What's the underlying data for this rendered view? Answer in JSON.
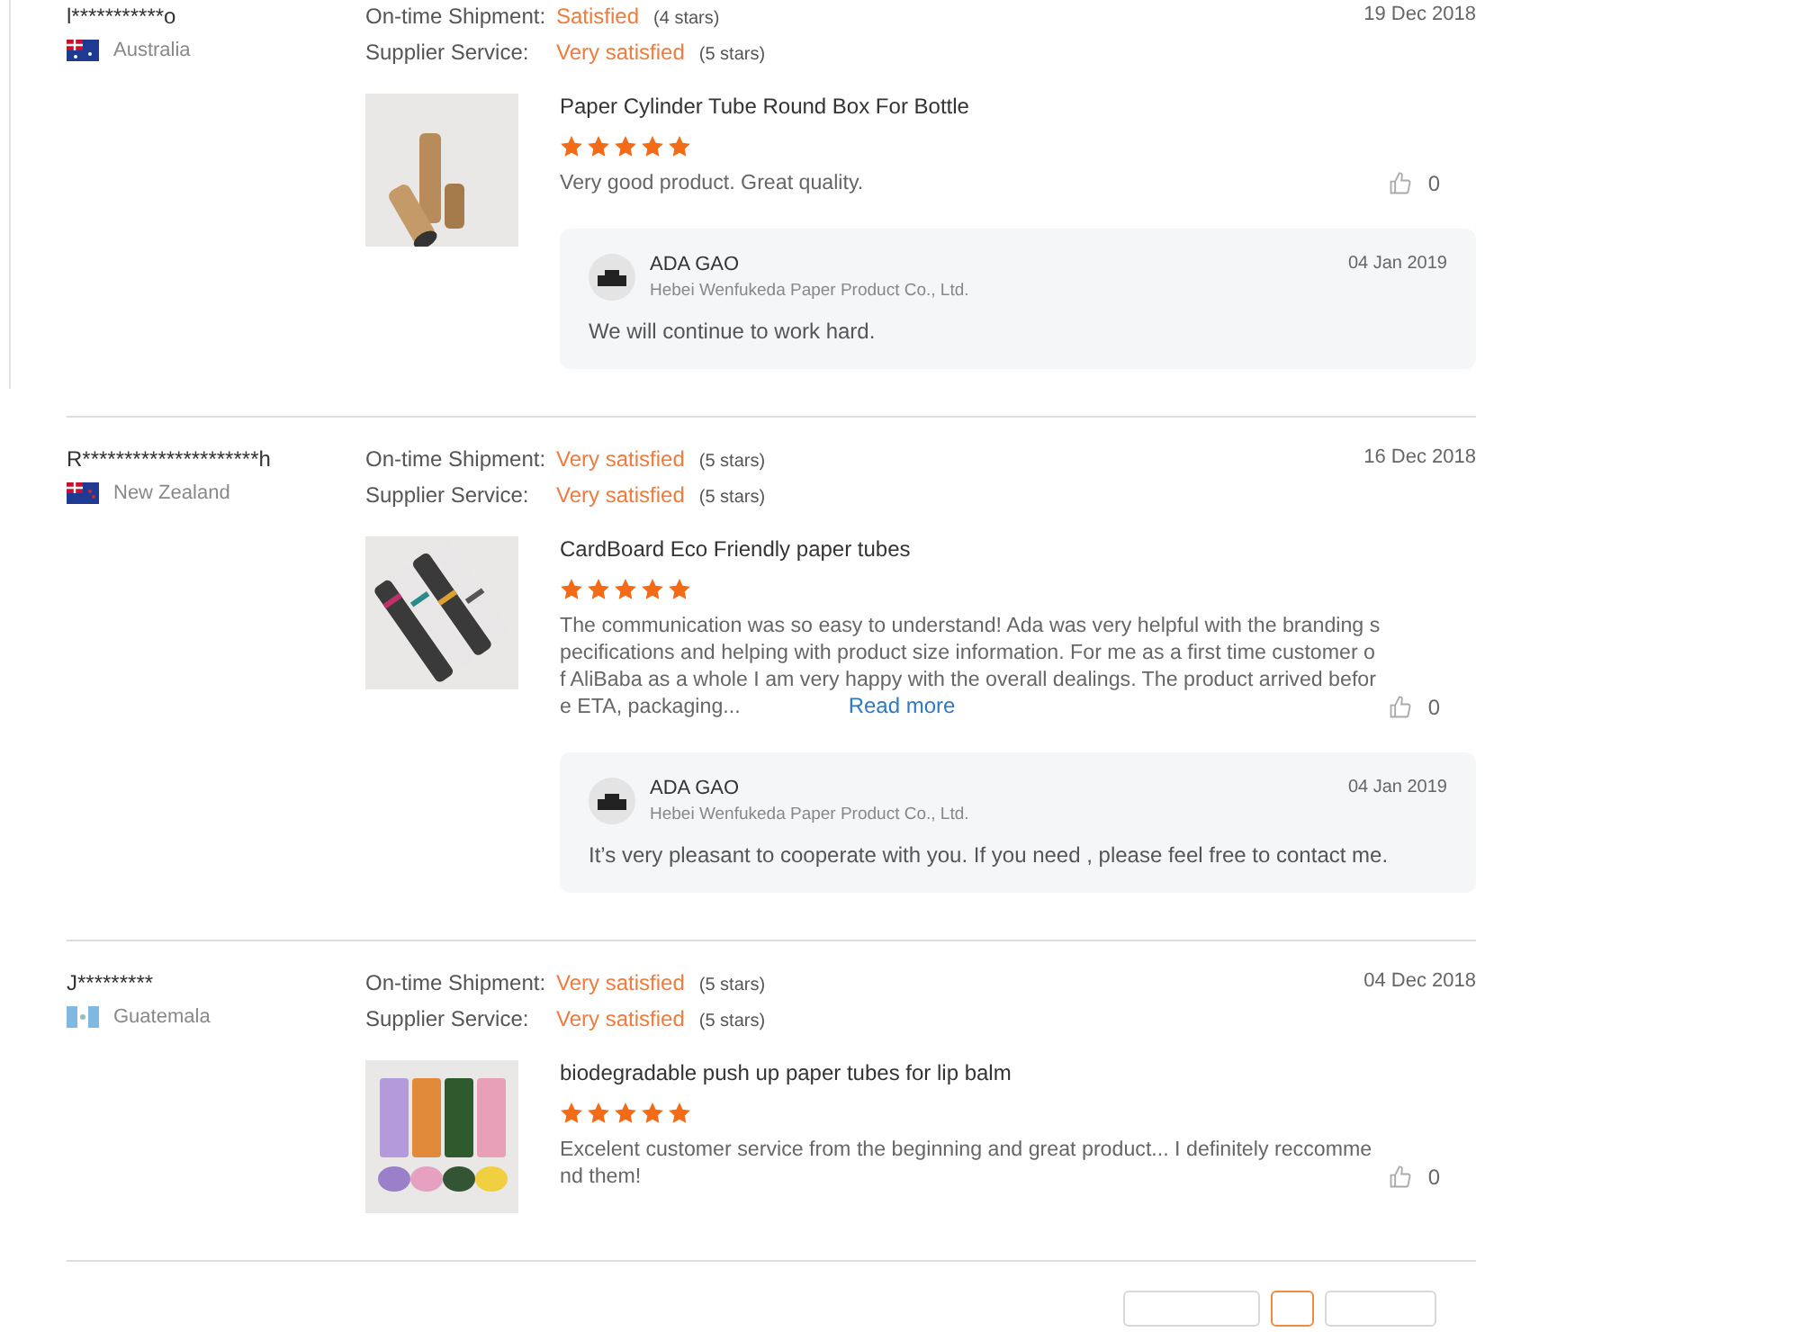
{
  "reviews": [
    {
      "buyer": "l***********o",
      "country": "Australia",
      "date": "19 Dec 2018",
      "ratings": [
        {
          "label": "On-time Shipment:",
          "value": "Satisfied",
          "stars_text": "(4 stars)"
        },
        {
          "label": "Supplier Service:",
          "value": "Very satisfied",
          "stars_text": "(5 stars)"
        }
      ],
      "product": "Paper Cylinder Tube Round Box For Bottle",
      "stars": 5,
      "text": "Very good product. Great quality.",
      "likes": "0",
      "reply": {
        "name": "ADA GAO",
        "company": "Hebei Wenfukeda Paper Product Co., Ltd.",
        "date": "04 Jan 2019",
        "text": "We will continue to work hard."
      }
    },
    {
      "buyer": "R*********************h",
      "country": "New Zealand",
      "date": "16 Dec 2018",
      "ratings": [
        {
          "label": "On-time Shipment:",
          "value": "Very satisfied",
          "stars_text": "(5 stars)"
        },
        {
          "label": "Supplier Service:",
          "value": "Very satisfied",
          "stars_text": "(5 stars)"
        }
      ],
      "product": "CardBoard Eco Friendly paper tubes",
      "stars": 5,
      "text": "The communication was so easy to understand! Ada was very helpful with the branding specifications and helping with product size information. For me as a first time customer of AliBaba as a whole I am very happy with the overall dealings. The product arrived before ETA, packaging...",
      "read_more": "Read more",
      "likes": "0",
      "reply": {
        "name": "ADA GAO",
        "company": "Hebei Wenfukeda Paper Product Co., Ltd.",
        "date": "04 Jan 2019",
        "text": "It’s very pleasant to cooperate with you. If you need , please feel free to contact me."
      }
    },
    {
      "buyer": "J*********",
      "country": "Guatemala",
      "date": "04 Dec 2018",
      "ratings": [
        {
          "label": "On-time Shipment:",
          "value": "Very satisfied",
          "stars_text": "(5 stars)"
        },
        {
          "label": "Supplier Service:",
          "value": "Very satisfied",
          "stars_text": "(5 stars)"
        }
      ],
      "product": "biodegradable push up paper tubes for lip balm",
      "stars": 5,
      "text": "Excelent customer service from the beginning and great product... I definitely reccommend them!",
      "likes": "0"
    }
  ],
  "pagination": [
    {
      "selected": false
    },
    {
      "selected": true
    },
    {
      "selected": false
    }
  ]
}
